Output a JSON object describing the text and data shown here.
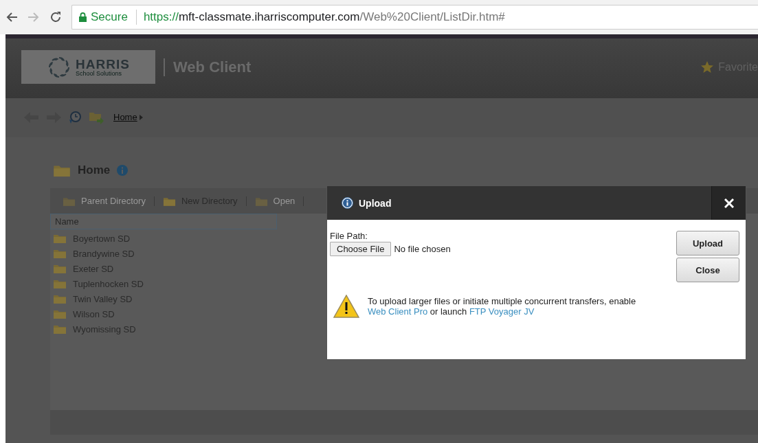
{
  "browser": {
    "secure_label": "Secure",
    "url": {
      "scheme": "https://",
      "host": "mft-classmate.iharriscomputer.com",
      "path": "/Web%20Client/ListDir.htm#"
    }
  },
  "header": {
    "logo_title": "HARRIS",
    "logo_subtitle": "School Solutions",
    "app_title": "Web Client",
    "favorites": "Favorite"
  },
  "nav": {
    "breadcrumb": "Home"
  },
  "folder": {
    "title": "Home"
  },
  "toolbar": [
    {
      "label": "Parent Directory",
      "disabled": true
    },
    {
      "label": "New Directory",
      "disabled": false
    },
    {
      "label": "Open",
      "disabled": true
    }
  ],
  "table": {
    "columns": [
      "Name"
    ],
    "rows": [
      {
        "name": "Boyertown SD"
      },
      {
        "name": "Brandywine SD"
      },
      {
        "name": "Exeter SD"
      },
      {
        "name": "Tuplenhocken SD"
      },
      {
        "name": "Twin Valley SD"
      },
      {
        "name": "Wilson SD"
      },
      {
        "name": "Wyomissing SD"
      }
    ]
  },
  "dialog": {
    "title": "Upload",
    "field_label": "File Path:",
    "choose_button": "Choose File",
    "file_status": "No file chosen",
    "buttons": [
      "Upload",
      "Close"
    ],
    "notice": [
      {
        "kind": "text",
        "text": "To upload larger files or initiate multiple concurrent transfers, enable "
      },
      {
        "kind": "link",
        "text": "Web Client Pro"
      },
      {
        "kind": "text",
        "text": " or launch "
      },
      {
        "kind": "link",
        "text": "FTP Voyager JV"
      }
    ]
  }
}
